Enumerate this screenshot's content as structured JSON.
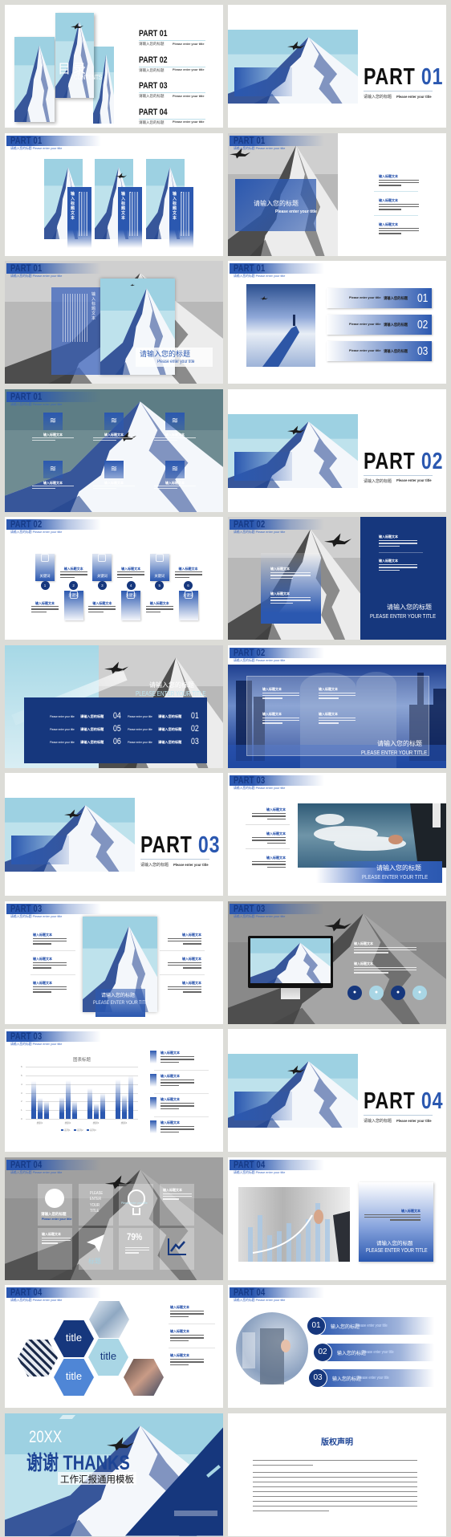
{
  "colors": {
    "navy": "#16377d",
    "blue": "#2b58b0",
    "light_blue": "#a9d6e5",
    "background": "#dcdcd7"
  },
  "slides": [
    {
      "type": "toc",
      "title": "目录",
      "title_en": "CONTENTS",
      "items": [
        {
          "part": "PART 01",
          "cn": "请输入您的标题",
          "en": "Please enter your title"
        },
        {
          "part": "PART 02",
          "cn": "请输入您的标题",
          "en": "Please enter your title"
        },
        {
          "part": "PART 03",
          "cn": "请输入您的标题",
          "en": "Please enter your title"
        },
        {
          "part": "PART 04",
          "cn": "请输入您的标题",
          "en": "Please enter your title"
        }
      ]
    },
    {
      "type": "section",
      "part": "PART",
      "num": "01",
      "cn": "请输入您的标题",
      "en": "Please enter your title"
    },
    {
      "part": "PART 01",
      "subtitle": "请输入您的标题  Please enter your title",
      "cards": [
        "输入标题文本",
        "输入标题文本",
        "输入标题文本"
      ]
    },
    {
      "part": "PART 01",
      "subtitle": "请输入您的标题  Please enter your title",
      "title": "请输入您的标题",
      "title_en": "Please enter your title",
      "items": [
        "输入标题文本",
        "输入标题文本",
        "输入标题文本"
      ]
    },
    {
      "part": "PART 01",
      "subtitle": "请输入您的标题  Please enter your title",
      "vertical": "输入标题文本",
      "title": "请输入您的标题",
      "title_en": "Please enter your title"
    },
    {
      "part": "PART 01",
      "subtitle": "请输入您的标题  Please enter your title",
      "rows": [
        {
          "en": "Please enter your title",
          "cn": "请输入您的标题",
          "num": "01"
        },
        {
          "en": "Please enter your title",
          "cn": "请输入您的标题",
          "num": "02"
        },
        {
          "en": "Please enter your title",
          "cn": "请输入您的标题",
          "num": "03"
        }
      ]
    },
    {
      "part": "PART 01",
      "subtitle": "请输入您的标题  Please enter your title",
      "items": [
        "输入标题文本",
        "输入标题文本",
        "输入标题文本",
        "输入标题文本",
        "输入标题文本",
        "输入标题文本"
      ],
      "icons": [
        "layers-icon",
        "chat-icon",
        "inbox-icon",
        "layers-icon",
        "chat-icon",
        "inbox-icon"
      ]
    },
    {
      "type": "section",
      "part": "PART",
      "num": "02",
      "cn": "请输入您的标题",
      "en": "Please enter your title"
    },
    {
      "part": "PART 02",
      "subtitle": "请输入您的标题  Please enter your title",
      "steps": [
        {
          "num": "1",
          "key": "关键词",
          "label": "输入标题文本"
        },
        {
          "num": "2",
          "key": "关键词",
          "label": "输入标题文本"
        },
        {
          "num": "3",
          "key": "关键词",
          "label": "输入标题文本"
        },
        {
          "num": "4",
          "key": "关键词",
          "label": "输入标题文本"
        },
        {
          "num": "5",
          "key": "关键词",
          "label": "输入标题文本"
        },
        {
          "num": "6",
          "key": "关键词",
          "label": "输入标题文本"
        }
      ]
    },
    {
      "part": "PART 02",
      "subtitle": "请输入您的标题  Please enter your title",
      "box_items": [
        "输入标题文本",
        "输入标题文本"
      ],
      "panel_items": [
        "输入标题文本",
        "输入标题文本"
      ],
      "title": "请输入您的标题",
      "title_en": "PLEASE ENTER YOUR TITLE"
    },
    {
      "title": "请输入您的标题",
      "title_en": "PLEASE ENTER YOUR TITLE",
      "rows": [
        {
          "en": "Please enter your title",
          "cn": "请输入您的标题",
          "num": "04"
        },
        {
          "en": "Please enter your title",
          "cn": "请输入您的标题",
          "num": "05"
        },
        {
          "en": "Please enter your title",
          "cn": "请输入您的标题",
          "num": "06"
        },
        {
          "en": "Please enter your title",
          "cn": "请输入您的标题",
          "num": "01"
        },
        {
          "en": "Please enter your title",
          "cn": "请输入您的标题",
          "num": "02"
        },
        {
          "en": "Please enter your title",
          "cn": "请输入您的标题",
          "num": "03"
        }
      ]
    },
    {
      "part": "PART 02",
      "subtitle": "请输入您的标题  Please enter your title",
      "items": [
        "输入标题文本",
        "输入标题文本",
        "输入标题文本",
        "输入标题文本"
      ],
      "title": "请输入您的标题",
      "title_en": "PLEASE ENTER YOUR TITLE"
    },
    {
      "type": "section",
      "part": "PART",
      "num": "03",
      "cn": "请输入您的标题",
      "en": "Please enter your title"
    },
    {
      "part": "PART 03",
      "subtitle": "请输入您的标题  Please enter your title",
      "items": [
        "输入标题文本",
        "输入标题文本",
        "输入标题文本"
      ],
      "title": "请输入您的标题",
      "title_en": "PLEASE ENTER YOUR TITLE"
    },
    {
      "part": "PART 03",
      "subtitle": "请输入您的标题  Please enter your title",
      "left_items": [
        "输入标题文本",
        "输入标题文本",
        "输入标题文本"
      ],
      "right_items": [
        "输入标题文本",
        "输入标题文本",
        "输入标题文本"
      ],
      "title": "请输入您的标题",
      "title_en": "PLEASE ENTER YOUR TITLE"
    },
    {
      "part": "PART 03",
      "subtitle": "请输入您的标题  Please enter your title",
      "items": [
        "输入标题文本",
        "输入标题文本"
      ],
      "icons": [
        "layers-icon",
        "lightbulb-icon",
        "printer-icon",
        "location-icon"
      ]
    },
    {
      "part": "PART 03",
      "subtitle": "请输入您的标题  Please enter your title",
      "items": [
        "输入标题文本",
        "输入标题文本",
        "输入标题文本",
        "输入标题文本"
      ]
    },
    {
      "type": "section",
      "part": "PART",
      "num": "04",
      "cn": "请输入您的标题",
      "en": "Please enter your title"
    },
    {
      "part": "PART 04",
      "subtitle": "请输入您的标题  Please enter your title",
      "globe_cn": "请输入您的标题",
      "globe_en": "Please enter your title",
      "please": [
        "PLEASE",
        "ENTER",
        "YOUR",
        "TITLE"
      ],
      "bulb_text": "Please enter your title",
      "item1": "输入标题文本",
      "item2": "输入标题文本",
      "percent": "79%",
      "plane_label": "标题"
    },
    {
      "part": "PART 04",
      "subtitle": "请输入您的标题  Please enter your title",
      "card_item": "输入标题文本",
      "title": "请输入您的标题",
      "title_en": "PLEASE ENTER YOUR TITLE"
    },
    {
      "part": "PART 04",
      "subtitle": "请输入您的标题  Please enter your title",
      "hexes": [
        "title",
        "title",
        "title"
      ],
      "items": [
        "输入标题文本",
        "输入标题文本",
        "输入标题文本"
      ]
    },
    {
      "part": "PART 04",
      "subtitle": "请输入您的标题  Please enter your title",
      "rows": [
        {
          "num": "01",
          "cn": "输入您的标题",
          "en": "Please enter your title"
        },
        {
          "num": "02",
          "cn": "输入您的标题",
          "en": "Please enter your title"
        },
        {
          "num": "03",
          "cn": "输入您的标题",
          "en": "Please enter your title"
        }
      ]
    },
    {
      "year": "20XX",
      "thanks": "谢谢 THANKS",
      "template": "工作汇报通用模板"
    },
    {
      "title": "版权声明"
    }
  ],
  "chart_data": {
    "type": "bar",
    "title": "图表标题",
    "categories": [
      "类别1",
      "类别2",
      "类别3",
      "类别4"
    ],
    "series": [
      {
        "name": "系列1",
        "values": [
          4.3,
          2.5,
          3.5,
          4.5
        ]
      },
      {
        "name": "系列2",
        "values": [
          2.4,
          4.4,
          1.8,
          2.8
        ]
      },
      {
        "name": "系列3",
        "values": [
          2,
          2,
          3,
          5
        ]
      }
    ],
    "ylim": [
      0,
      6
    ],
    "yticks": [
      "0",
      "1",
      "2",
      "3",
      "4",
      "5",
      "6"
    ],
    "grid": true,
    "legend": "bottom"
  }
}
